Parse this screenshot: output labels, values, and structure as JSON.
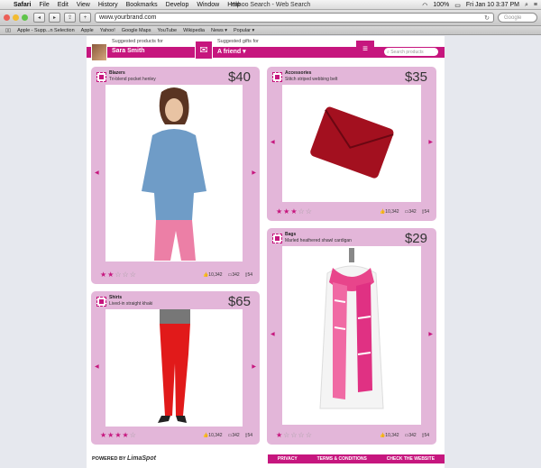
{
  "menubar": {
    "app": "Safari",
    "items": [
      "File",
      "Edit",
      "View",
      "History",
      "Bookmarks",
      "Develop",
      "Window",
      "Help"
    ],
    "window_title": "Yahoo Search - Web Search",
    "battery": "100%",
    "clock": "Fri Jan 10  3:37 PM"
  },
  "toolbar": {
    "url": "www.yourbrand.com",
    "search_placeholder": "Google"
  },
  "bookmarks": [
    "Apple - Supp...n Selection",
    "Apple",
    "Yahoo!",
    "Google Maps",
    "YouTube",
    "Wikipedia",
    "News ▾",
    "Popular ▾"
  ],
  "header": {
    "products_label": "Suggested products for",
    "products_name": "Sara Smith",
    "gifts_label": "Suggested gifts for",
    "gifts_name": "A friend ▾",
    "search_placeholder": "Search products"
  },
  "cards": [
    {
      "category": "Blazers",
      "desc": "Tri-blend pocket henley",
      "price": "$40",
      "rating": 2,
      "likes": "10,342",
      "comments": "342",
      "saves": "54"
    },
    {
      "category": "Accessories",
      "desc": "Stitch striped webbing belt",
      "price": "$35",
      "rating": 3,
      "likes": "10,342",
      "comments": "342",
      "saves": "54"
    },
    {
      "category": "Shirts",
      "desc": "Lived-in straight khaki",
      "price": "$65",
      "rating": 4,
      "likes": "10,342",
      "comments": "342",
      "saves": "54"
    },
    {
      "category": "Bags",
      "desc": "Marled heathered shawl cardigan",
      "price": "$29",
      "rating": 1,
      "likes": "10,342",
      "comments": "342",
      "saves": "54"
    }
  ],
  "footer": {
    "powered_label": "POWERED BY",
    "brand": "LimaSpot",
    "links": [
      "PRIVACY",
      "TERMS & CONDITIONS",
      "CHECK THE WEBSITE"
    ]
  },
  "colors": {
    "accent": "#c6167e",
    "card": "#e3b6d9"
  }
}
